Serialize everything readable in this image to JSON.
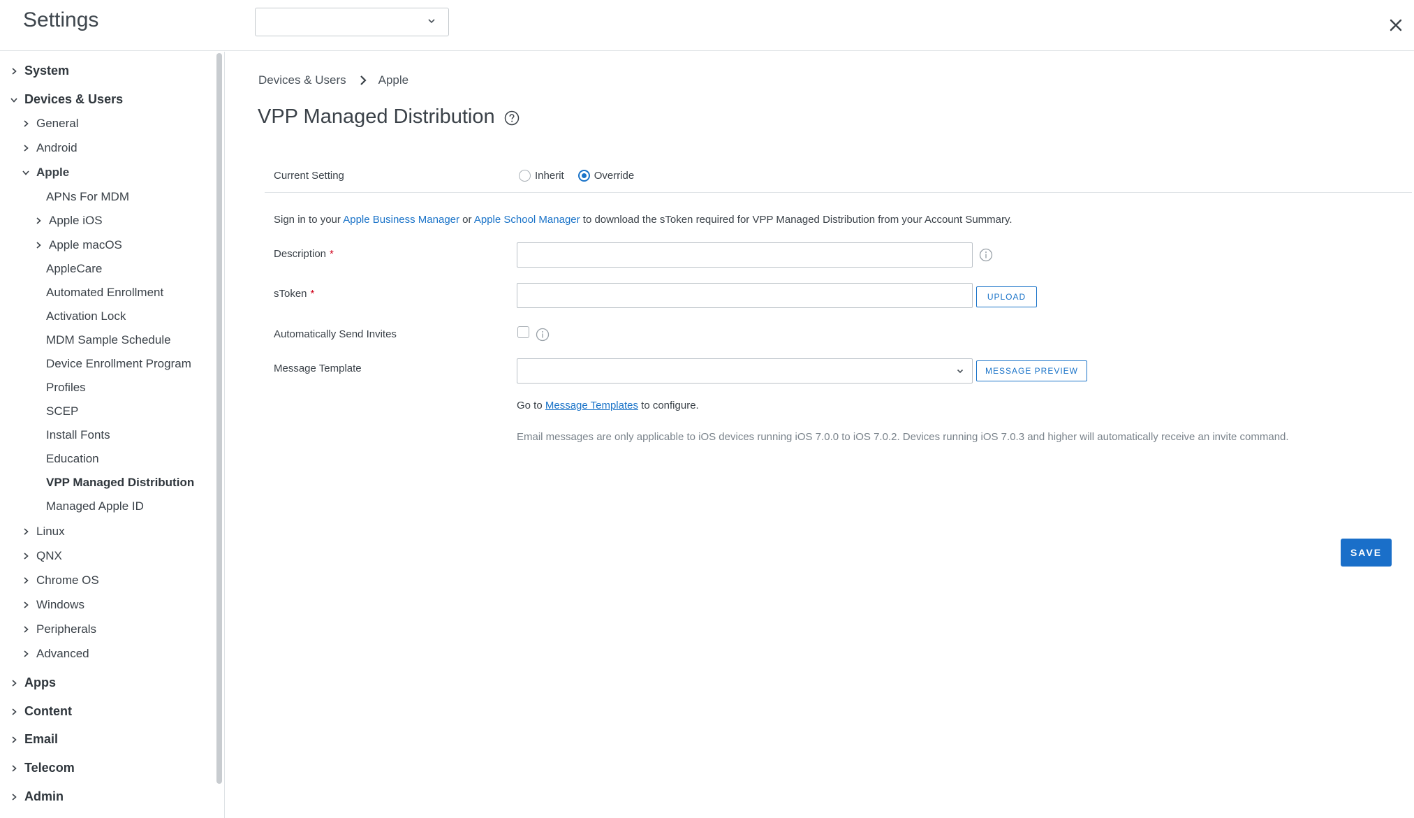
{
  "header": {
    "title": "Settings",
    "org_select_value": ""
  },
  "sidebar": {
    "items": [
      {
        "label": "System",
        "level": 0,
        "caret": "right"
      },
      {
        "label": "Devices & Users",
        "level": 0,
        "caret": "down"
      },
      {
        "label": "General",
        "level": 1,
        "caret": "right"
      },
      {
        "label": "Android",
        "level": 1,
        "caret": "right"
      },
      {
        "label": "Apple",
        "level": 1,
        "caret": "down"
      },
      {
        "label": "APNs For MDM",
        "level": 2,
        "caret": "none"
      },
      {
        "label": "Apple iOS",
        "level": 2,
        "caret": "right"
      },
      {
        "label": "Apple macOS",
        "level": 2,
        "caret": "right"
      },
      {
        "label": "AppleCare",
        "level": 2,
        "caret": "none"
      },
      {
        "label": "Automated Enrollment",
        "level": 2,
        "caret": "none"
      },
      {
        "label": "Activation Lock",
        "level": 2,
        "caret": "none"
      },
      {
        "label": "MDM Sample Schedule",
        "level": 2,
        "caret": "none"
      },
      {
        "label": "Device Enrollment Program",
        "level": 2,
        "caret": "none"
      },
      {
        "label": "Profiles",
        "level": 2,
        "caret": "none"
      },
      {
        "label": "SCEP",
        "level": 2,
        "caret": "none"
      },
      {
        "label": "Install Fonts",
        "level": 2,
        "caret": "none"
      },
      {
        "label": "Education",
        "level": 2,
        "caret": "none"
      },
      {
        "label": "VPP Managed Distribution",
        "level": 2,
        "caret": "none",
        "active": true
      },
      {
        "label": "Managed Apple ID",
        "level": 2,
        "caret": "none"
      },
      {
        "label": "Linux",
        "level": 1,
        "caret": "right"
      },
      {
        "label": "QNX",
        "level": 1,
        "caret": "right"
      },
      {
        "label": "Chrome OS",
        "level": 1,
        "caret": "right"
      },
      {
        "label": "Windows",
        "level": 1,
        "caret": "right"
      },
      {
        "label": "Peripherals",
        "level": 1,
        "caret": "right"
      },
      {
        "label": "Advanced",
        "level": 1,
        "caret": "right"
      },
      {
        "label": "Apps",
        "level": 0,
        "caret": "right"
      },
      {
        "label": "Content",
        "level": 0,
        "caret": "right"
      },
      {
        "label": "Email",
        "level": 0,
        "caret": "right"
      },
      {
        "label": "Telecom",
        "level": 0,
        "caret": "right"
      },
      {
        "label": "Admin",
        "level": 0,
        "caret": "right"
      }
    ]
  },
  "main": {
    "breadcrumb": [
      "Devices & Users",
      "Apple"
    ],
    "title": "VPP Managed Distribution",
    "current_setting": {
      "label": "Current Setting",
      "options": [
        "Inherit",
        "Override"
      ],
      "selected": "Override"
    },
    "info": {
      "prefix": "Sign in to your ",
      "link1": "Apple Business Manager",
      "middle": " or ",
      "link2": "Apple School Manager",
      "suffix": " to download the sToken required for VPP Managed Distribution from your Account Summary."
    },
    "fields": {
      "description_label": "Description",
      "description_value": "",
      "stoken_label": "sToken",
      "stoken_value": "",
      "upload_label": "UPLOAD",
      "auto_invites_label": "Automatically Send Invites",
      "auto_invites_checked": false,
      "message_template_label": "Message Template",
      "message_template_value": "",
      "message_preview_label": "MESSAGE PREVIEW",
      "required_mark": "*"
    },
    "goto": {
      "prefix": "Go to ",
      "link": "Message Templates",
      "suffix": " to configure."
    },
    "note": "Email messages are only applicable to iOS devices running iOS 7.0.0 to iOS 7.0.2. Devices running iOS 7.0.3 and higher will automatically receive an invite command.",
    "save_label": "SAVE"
  },
  "colors": {
    "accent": "#1a73c8",
    "required": "#d0021b",
    "border": "#dfe3e6"
  }
}
